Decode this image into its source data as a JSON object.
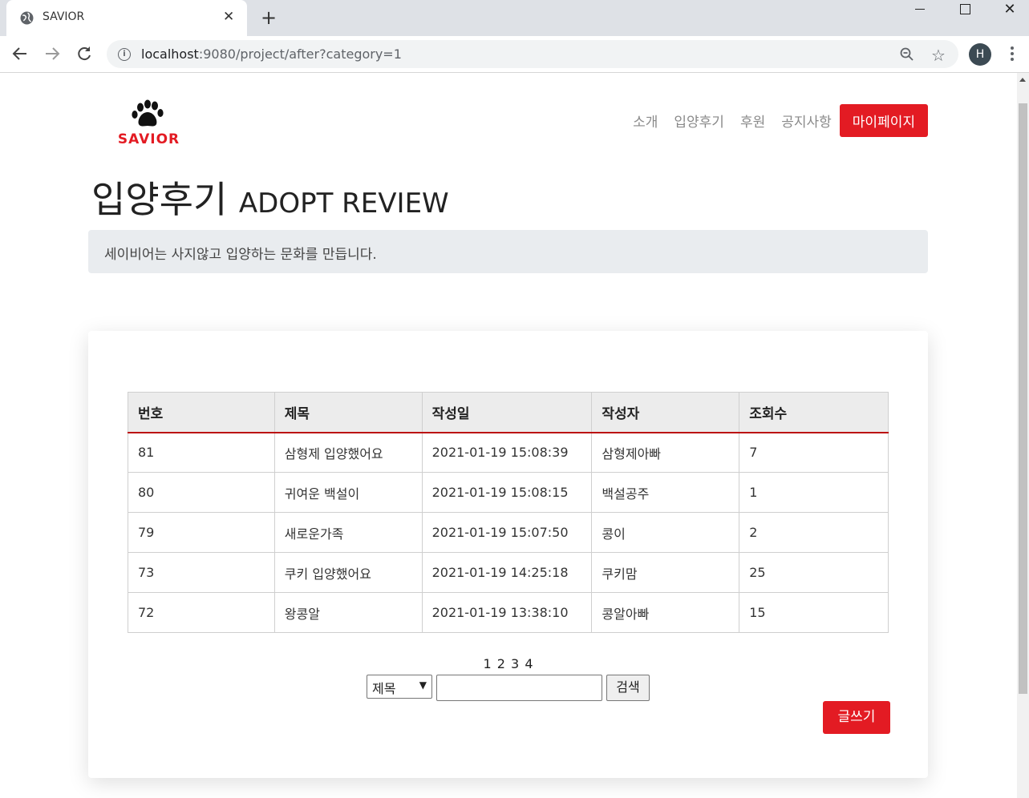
{
  "browser": {
    "tab_title": "SAVIOR",
    "url_host": "localhost",
    "url_rest": ":9080/project/after?category=1",
    "avatar_letter": "H"
  },
  "site": {
    "logo_text": "SAVIOR",
    "nav": [
      "소개",
      "입양후기",
      "후원",
      "공지사항"
    ],
    "mypage_label": "마이페이지",
    "brand_color": "#e31b23"
  },
  "header": {
    "title": "입양후기",
    "subtitle": "ADOPT REVIEW",
    "tagline": "세이비어는 사지않고 입양하는 문화를 만듭니다."
  },
  "board": {
    "columns": [
      "번호",
      "제목",
      "작성일",
      "작성자",
      "조회수"
    ],
    "rows": [
      [
        "81",
        "삼형제 입양했어요",
        "2021-01-19 15:08:39",
        "삼형제아빠",
        "7"
      ],
      [
        "80",
        "귀여운 백설이",
        "2021-01-19 15:08:15",
        "백설공주",
        "1"
      ],
      [
        "79",
        "새로운가족",
        "2021-01-19 15:07:50",
        "콩이",
        "2"
      ],
      [
        "73",
        "쿠키 입양했어요",
        "2021-01-19 14:25:18",
        "쿠키맘",
        "25"
      ],
      [
        "72",
        "왕콩알",
        "2021-01-19 13:38:10",
        "콩알아빠",
        "15"
      ]
    ],
    "pages": [
      "1",
      "2",
      "3",
      "4"
    ]
  },
  "search": {
    "field_selected": "제목",
    "query": "",
    "button_label": "검색"
  },
  "write_label": "글쓰기"
}
